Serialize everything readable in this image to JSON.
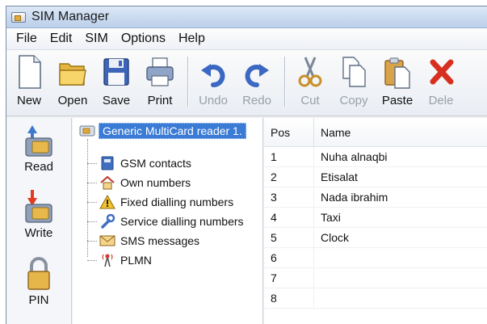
{
  "window": {
    "title": "SIM Manager"
  },
  "menu": [
    "File",
    "Edit",
    "SIM",
    "Options",
    "Help"
  ],
  "toolbar": {
    "new": "New",
    "open": "Open",
    "save": "Save",
    "print": "Print",
    "undo": "Undo",
    "redo": "Redo",
    "cut": "Cut",
    "copy": "Copy",
    "paste": "Paste",
    "delete": "Dele"
  },
  "sidebar": {
    "read": "Read",
    "write": "Write",
    "pin": "PIN"
  },
  "tree": {
    "root": "Generic MultiCard reader 1.",
    "nodes": [
      {
        "label": "GSM contacts",
        "icon": "contacts-book-icon"
      },
      {
        "label": "Own numbers",
        "icon": "home-icon"
      },
      {
        "label": "Fixed dialling numbers",
        "icon": "warning-triangle-icon"
      },
      {
        "label": "Service dialling numbers",
        "icon": "wrench-icon"
      },
      {
        "label": "SMS messages",
        "icon": "envelope-icon"
      },
      {
        "label": "PLMN",
        "icon": "antenna-icon"
      }
    ]
  },
  "list": {
    "columns": [
      "Pos",
      "Name"
    ],
    "rows": [
      {
        "pos": "1",
        "name": "Nuha alnaqbi"
      },
      {
        "pos": "2",
        "name": "Etisalat"
      },
      {
        "pos": "3",
        "name": "Nada ibrahim"
      },
      {
        "pos": "4",
        "name": "Taxi"
      },
      {
        "pos": "5",
        "name": "Clock"
      },
      {
        "pos": "6",
        "name": ""
      },
      {
        "pos": "7",
        "name": ""
      },
      {
        "pos": "8",
        "name": ""
      }
    ]
  }
}
